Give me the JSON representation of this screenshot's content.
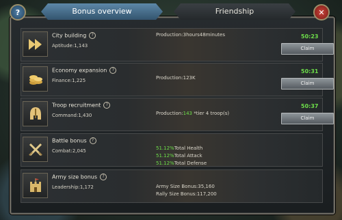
{
  "tabs": {
    "active": "Bonus overview",
    "inactive": "Friendship"
  },
  "buttons": {
    "help": "?",
    "close": "✕"
  },
  "rows": [
    {
      "title": "City building",
      "stat": "Aptitude:1,143",
      "production_label": "Production:",
      "production_value": "3hours48minutes",
      "timer": "50:23",
      "claim": "Claim",
      "icon": "fast-forward-icon"
    },
    {
      "title": "Economy expansion",
      "stat": "Finance:1,225",
      "production_label": "Production:",
      "production_value": "123K",
      "timer": "50:31",
      "claim": "Claim",
      "icon": "coins-icon"
    },
    {
      "title": "Troop recruitment",
      "stat": "Command:1,430",
      "production_label": "Production:",
      "production_value": "143",
      "production_suffix": " *tier 4 troop(s)",
      "timer": "50:37",
      "claim": "Claim",
      "icon": "helmet-icon"
    },
    {
      "title": "Battle bonus",
      "stat": "Combat:2,045",
      "bonuses": [
        {
          "value": "51.12%",
          "label": "Total Health"
        },
        {
          "value": "51.12%",
          "label": "Total Attack"
        },
        {
          "value": "51.12%",
          "label": "Total Defense"
        }
      ],
      "icon": "crossed-swords-icon"
    },
    {
      "title": "Army size bonus",
      "stat": "Leadership:1,172",
      "army_size": "Army Size Bonus:35,160",
      "rally_size": "Rally Size Bonus:117,200",
      "icon": "castle-flag-icon"
    }
  ]
}
